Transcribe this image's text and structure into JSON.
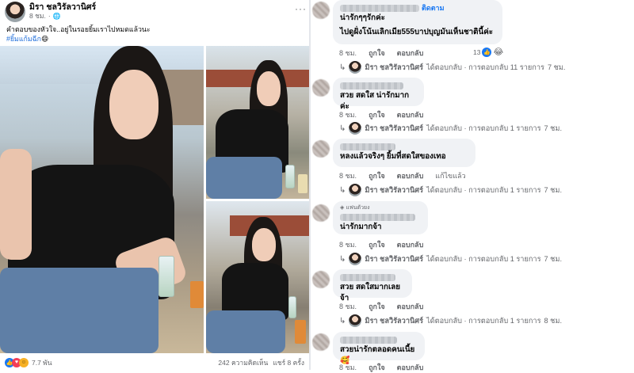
{
  "post": {
    "author": "มิรา ชลวิรัลวานิศร์",
    "time": "8 ชม.",
    "privacy_icon": "globe-icon",
    "text": "คำตอบของหัวใจ..อยู่ในรอยยิ้มเราไปหมดแล้วนะ",
    "hashtag": "#ยิ้มแก้มฉีก",
    "hashtag_emoji": "😄",
    "reactions_count": "7.7 พัน",
    "comments_count": "242 ความคิดเห็น",
    "shares_count": "แชร์ 8 ครั้ง"
  },
  "comments": [
    {
      "follow_label": "ติดตาม",
      "badge": "",
      "text_lines": [
        "น่ารักๆๆรักค่ะ",
        "ไปดูฝั่งโน้นเลิกเมีย555บาปบุญมันเห็นชาตินี้ค่ะ"
      ],
      "time": "8 ชม.",
      "like_label": "ถูกใจ",
      "reply_label": "ตอบกลับ",
      "reaction_count": "13",
      "reply_summary": {
        "author": "มิรา ชลวิรัลวานิศร์",
        "text": "ได้ตอบกลับ · การตอบกลับ 11 รายการ",
        "time": "7 ชม."
      }
    },
    {
      "follow_label": "",
      "badge": "",
      "text_lines": [
        "สวย สดใส น่ารักมากค่ะ"
      ],
      "time": "8 ชม.",
      "like_label": "ถูกใจ",
      "reply_label": "ตอบกลับ",
      "reaction_count": "",
      "reply_summary": {
        "author": "มิรา ชลวิรัลวานิศร์",
        "text": "ได้ตอบกลับ · การตอบกลับ 1 รายการ",
        "time": "7 ชม."
      }
    },
    {
      "follow_label": "",
      "badge": "",
      "text_lines": [
        "หลงแล้วจริงๆ ยิ้มที่สดใสของเทอ"
      ],
      "time": "8 ชม.",
      "like_label": "ถูกใจ",
      "reply_label": "ตอบกลับ",
      "edited_label": "แก้ไขแล้ว",
      "reaction_count": "",
      "reply_summary": {
        "author": "มิรา ชลวิรัลวานิศร์",
        "text": "ได้ตอบกลับ · การตอบกลับ 1 รายการ",
        "time": "7 ชม."
      }
    },
    {
      "follow_label": "",
      "badge": "แฟนตัวยง",
      "text_lines": [
        "น่ารักมากจ้า"
      ],
      "time": "8 ชม.",
      "like_label": "ถูกใจ",
      "reply_label": "ตอบกลับ",
      "reaction_count": "",
      "reply_summary": {
        "author": "มิรา ชลวิรัลวานิศร์",
        "text": "ได้ตอบกลับ · การตอบกลับ 1 รายการ",
        "time": "7 ชม."
      }
    },
    {
      "follow_label": "",
      "badge": "",
      "text_lines": [
        "สวย สดใสมากเลยจ้า"
      ],
      "time": "8 ชม.",
      "like_label": "ถูกใจ",
      "reply_label": "ตอบกลับ",
      "reaction_count": "",
      "reply_summary": {
        "author": "มิรา ชลวิรัลวานิศร์",
        "text": "ได้ตอบกลับ · การตอบกลับ 1 รายการ",
        "time": "8 ชม."
      }
    },
    {
      "follow_label": "",
      "badge": "",
      "text_lines": [
        "สวยน่ารักตลอดคนเนี้ย🥰"
      ],
      "time": "8 ชม.",
      "like_label": "ถูกใจ",
      "reply_label": "ตอบกลับ",
      "reaction_count": ""
    }
  ],
  "colors": {
    "link": "#1877f2",
    "bubble": "#f0f2f5",
    "muted": "#65676b"
  }
}
